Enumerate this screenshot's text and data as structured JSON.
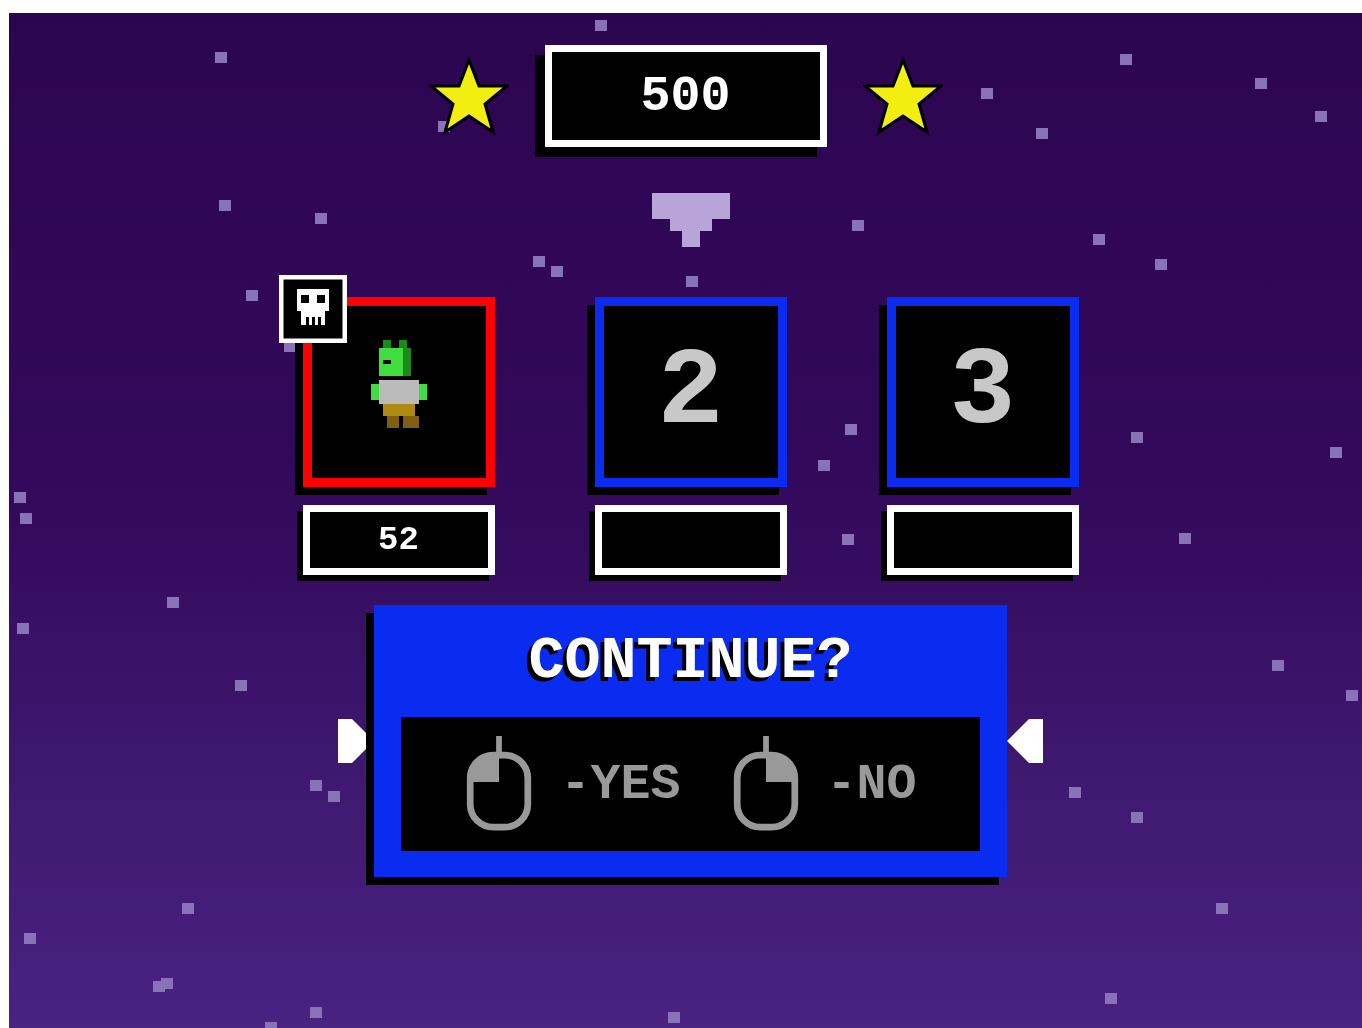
{
  "score": "500",
  "slots": [
    {
      "kind": "character",
      "color": "#ff0000",
      "selected": false,
      "dead": true,
      "label": "52"
    },
    {
      "kind": "number",
      "color": "#0a2cf0",
      "selected": true,
      "dead": false,
      "number": "2"
    },
    {
      "kind": "number",
      "color": "#0a2cf0",
      "selected": false,
      "dead": false,
      "number": "3"
    }
  ],
  "prompt": {
    "title": "CONTINUE?",
    "options": [
      {
        "kind": "left-click",
        "label": "-YES"
      },
      {
        "kind": "right-click",
        "label": "-NO"
      }
    ]
  }
}
